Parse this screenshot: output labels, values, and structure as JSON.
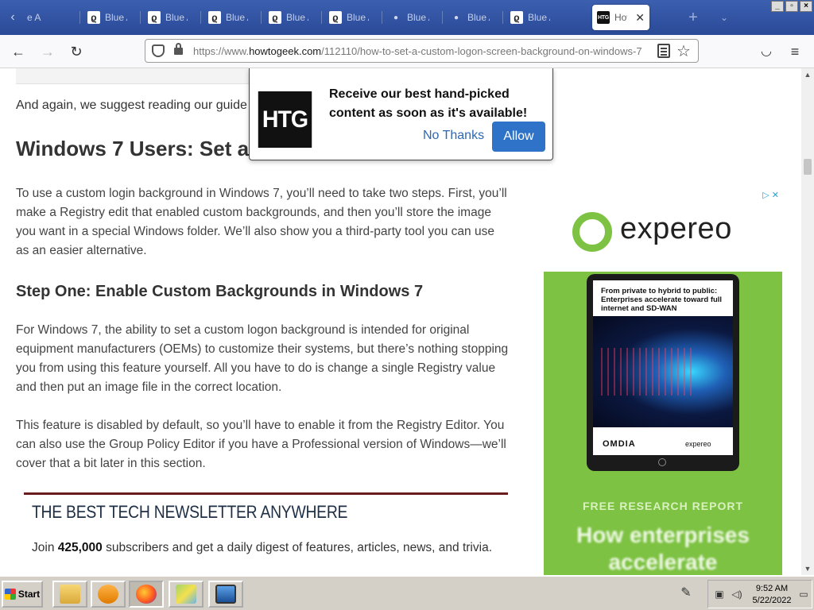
{
  "browser": {
    "tabs": [
      {
        "label": "e A",
        "icon": "magnifier-icon",
        "kind": "partial"
      },
      {
        "label": "Blue A",
        "icon": "magnifier-icon"
      },
      {
        "label": "Blue A",
        "icon": "magnifier-icon"
      },
      {
        "label": "Blue A",
        "icon": "magnifier-icon"
      },
      {
        "label": "Blue A",
        "icon": "magnifier-icon"
      },
      {
        "label": "Blue A",
        "icon": "magnifier-icon"
      },
      {
        "label": "Blue A",
        "icon": "dot-icon"
      },
      {
        "label": "Blue A",
        "icon": "dot-icon"
      },
      {
        "label": "Blue A",
        "icon": "magnifier-icon"
      },
      {
        "label": "How",
        "icon": "htg-favicon",
        "active": true
      }
    ],
    "active_tab_favicon_text": "HTG",
    "url_prefix": "https://www.",
    "url_host": "howtogeek.com",
    "url_rest": "/112110/how-to-set-a-custom-logon-screen-background-on-windows-7",
    "window_controls": [
      "_",
      "▫",
      "×"
    ]
  },
  "popup": {
    "logo": "HTG",
    "message": "Receive our best hand-picked content as soon as it's available!",
    "no_thanks": "No Thanks",
    "allow": "Allow"
  },
  "article": {
    "intro": "And again, we suggest reading our guide",
    "heading": "Windows 7 Users: Set a",
    "para1": "To use a custom login background in Windows 7, you’ll need to take two steps. First, you’ll make a Registry edit that enabled custom backgrounds, and then you’ll store the image you want in a special Windows folder. We’ll also show you a third-party tool you can use as an easier alternative.",
    "step_heading": "Step One: Enable Custom Backgrounds in Windows 7",
    "para2": "For Windows 7, the ability to set a custom logon background is intended for original equipment manufacturers (OEMs) to customize their systems, but there’s nothing stopping you from using this feature yourself. All you have to do is change a single Registry value and then put an image file in the correct location.",
    "para3": "This feature is disabled by default, so you’ll have to enable it from the Registry Editor. You can also use the Group Policy Editor if you have a Professional version of Windows—we’ll cover that a bit later in this section."
  },
  "newsletter": {
    "title": "THE BEST TECH NEWSLETTER ANYWHERE",
    "text_prefix": "Join ",
    "count": "425,000",
    "text_suffix": " subscribers and get a daily digest of features, articles, news, and trivia."
  },
  "ad": {
    "brand": "expereo",
    "screen_text": "From private to hybrid to public: Enterprises accelerate toward full internet and SD-WAN",
    "screen_partner": "OMDIA",
    "screen_brand": "expereo",
    "report_label": "FREE RESEARCH REPORT",
    "headline": "How enterprises accelerate",
    "choice": "▷ ✕",
    "colors": {
      "green": "#7dc242"
    }
  },
  "taskbar": {
    "start": "Start",
    "clock_time": "9:52 AM",
    "clock_date": "5/22/2022"
  }
}
